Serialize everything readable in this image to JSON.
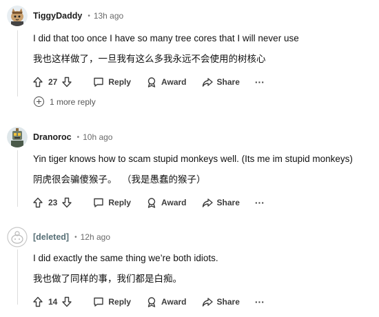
{
  "comments": [
    {
      "author": "TiggyDaddy",
      "separator": "•",
      "time": "13h ago",
      "text_en": "I did that too once I have so many tree cores that I will never use",
      "text_zh": "我也这样做了，一旦我有这么多我永远不会使用的树核心",
      "votes": "27",
      "reply": "Reply",
      "award": "Award",
      "share": "Share",
      "more": "···",
      "avatar_icon": "cat-avatar-icon"
    },
    {
      "author": "Dranoroc",
      "separator": "•",
      "time": "10h ago",
      "text_en": "Yin tiger knows how to scam stupid monkeys well. (Its me im stupid monkeys)",
      "text_zh": "阴虎很会骗傻猴子。  （我是愚蠢的猴子）",
      "votes": "23",
      "reply": "Reply",
      "award": "Award",
      "share": "Share",
      "more": "···",
      "avatar_icon": "robot-avatar-icon"
    },
    {
      "author": "[deleted]",
      "separator": "•",
      "time": "12h ago",
      "text_en": "I did exactly the same thing we’re both idiots.",
      "text_zh": "我也做了同样的事，我们都是白痴。",
      "votes": "14",
      "reply": "Reply",
      "award": "Award",
      "share": "Share",
      "more": "···",
      "avatar_icon": "deleted-avatar-icon"
    }
  ],
  "more_replies": "1 more reply",
  "colors": {
    "thread_line": "#dcdcdc",
    "deleted_author": "#576f76",
    "action_text": "#3c3c3c"
  }
}
